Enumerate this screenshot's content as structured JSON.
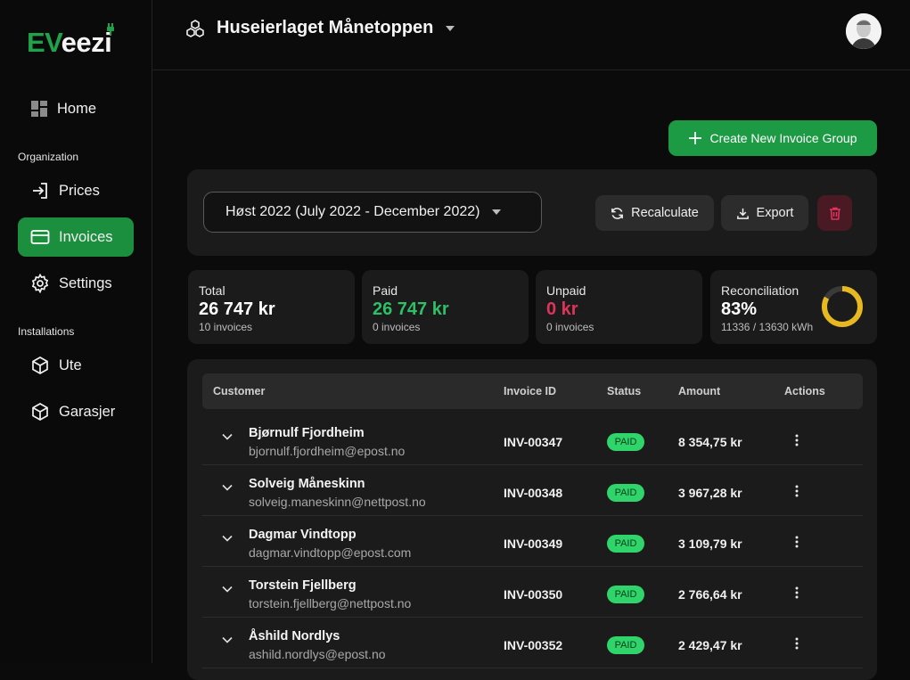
{
  "brand": {
    "logo_ev": "EV",
    "logo_rest": "eezi"
  },
  "sidebar": {
    "home_label": "Home",
    "org_section": "Organization",
    "items": [
      {
        "label": "Prices"
      },
      {
        "label": "Invoices"
      },
      {
        "label": "Settings"
      }
    ],
    "install_section": "Installations",
    "installations": [
      {
        "label": "Ute"
      },
      {
        "label": "Garasjer"
      }
    ]
  },
  "header": {
    "org_name": "Huseierlaget Månetoppen"
  },
  "toolbar": {
    "create_label": "Create New Invoice Group",
    "period_label": "Høst 2022 (July 2022 - December 2022)",
    "recalc_label": "Recalculate",
    "export_label": "Export"
  },
  "stats": {
    "total": {
      "label": "Total",
      "value": "26 747 kr",
      "sub": "10 invoices"
    },
    "paid": {
      "label": "Paid",
      "value": "26 747 kr",
      "sub": "0 invoices"
    },
    "unpaid": {
      "label": "Unpaid",
      "value": "0 kr",
      "sub": "0 invoices"
    },
    "recon": {
      "label": "Reconciliation",
      "value": "83%",
      "sub": "11336 / 13630 kWh",
      "fraction": 0.83
    }
  },
  "colors": {
    "accent": "#1c9a44",
    "paid": "#2fbf66",
    "unpaid": "#e0335a",
    "donut": "#e8b820"
  },
  "table": {
    "headers": {
      "customer": "Customer",
      "invoice_id": "Invoice ID",
      "status": "Status",
      "amount": "Amount",
      "actions": "Actions"
    },
    "rows": [
      {
        "name": "Bjørnulf Fjordheim",
        "email": "bjornulf.fjordheim@epost.no",
        "invoice": "INV-00347",
        "status": "PAID",
        "amount": "8 354,75 kr"
      },
      {
        "name": "Solveig Måneskinn",
        "email": "solveig.maneskinn@nettpost.no",
        "invoice": "INV-00348",
        "status": "PAID",
        "amount": "3 967,28 kr"
      },
      {
        "name": "Dagmar Vindtopp",
        "email": "dagmar.vindtopp@epost.com",
        "invoice": "INV-00349",
        "status": "PAID",
        "amount": "3 109,79 kr"
      },
      {
        "name": "Torstein Fjellberg",
        "email": "torstein.fjellberg@nettpost.no",
        "invoice": "INV-00350",
        "status": "PAID",
        "amount": "2 766,64 kr"
      },
      {
        "name": "Åshild Nordlys",
        "email": "ashild.nordlys@epost.no",
        "invoice": "INV-00352",
        "status": "PAID",
        "amount": "2 429,47 kr"
      }
    ]
  }
}
